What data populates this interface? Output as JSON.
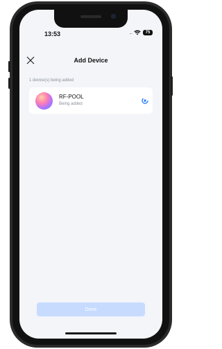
{
  "status_bar": {
    "time": "13:53",
    "signal_dots": "....",
    "battery_level": "75"
  },
  "header": {
    "title": "Add Device",
    "close_icon": "close-icon"
  },
  "list": {
    "count_text": "1 device(s) being added",
    "devices": [
      {
        "name": "RF-POOL",
        "status": "Being added",
        "icon": "device-gradient-avatar"
      }
    ]
  },
  "footer": {
    "done_label": "Done"
  },
  "colors": {
    "screen_bg": "#f3f5f9",
    "accent": "#1f7bff",
    "done_button_disabled": "#c7dbff"
  }
}
